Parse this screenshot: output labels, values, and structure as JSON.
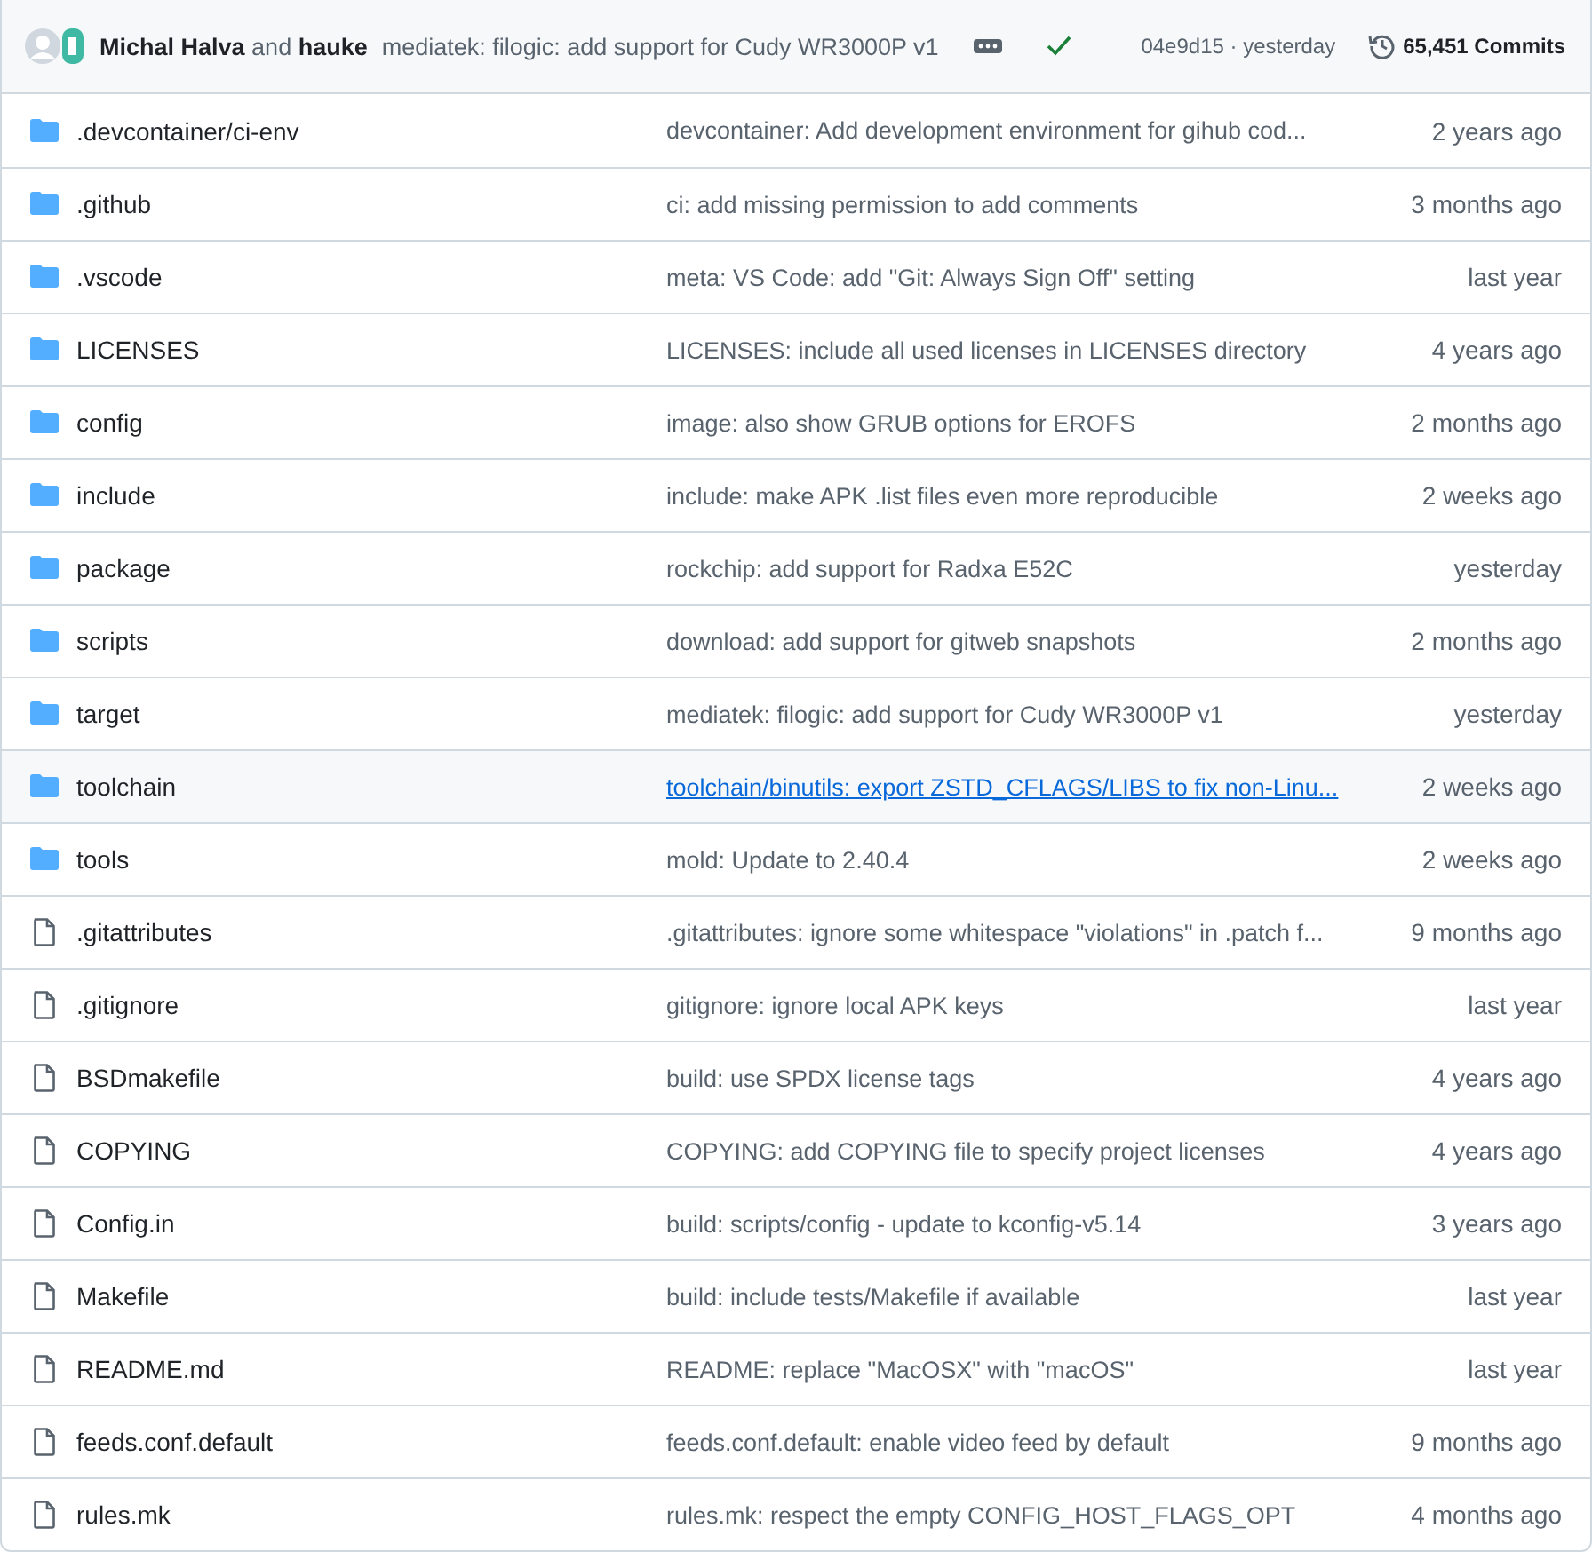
{
  "commit_header": {
    "author": "Michal Halva",
    "joiner": "and",
    "coauthor": "hauke",
    "message": "mediatek: filogic: add support for Cudy WR3000P v1",
    "checks_passed": true,
    "hash": "04e9d15",
    "separator": "·",
    "time": "yesterday",
    "commits": "65,451 Commits"
  },
  "files": [
    {
      "kind": "folder",
      "name": ".devcontainer/ci-env",
      "message": "devcontainer: Add development environment for gihub cod...",
      "time": "2 years ago",
      "hovered": false
    },
    {
      "kind": "folder",
      "name": ".github",
      "message": "ci: add missing permission to add comments",
      "time": "3 months ago",
      "hovered": false
    },
    {
      "kind": "folder",
      "name": ".vscode",
      "message": "meta: VS Code: add \"Git: Always Sign Off\" setting",
      "time": "last year",
      "hovered": false
    },
    {
      "kind": "folder",
      "name": "LICENSES",
      "message": "LICENSES: include all used licenses in LICENSES directory",
      "time": "4 years ago",
      "hovered": false
    },
    {
      "kind": "folder",
      "name": "config",
      "message": "image: also show GRUB options for EROFS",
      "time": "2 months ago",
      "hovered": false
    },
    {
      "kind": "folder",
      "name": "include",
      "message": "include: make APK .list files even more reproducible",
      "time": "2 weeks ago",
      "hovered": false
    },
    {
      "kind": "folder",
      "name": "package",
      "message": "rockchip: add support for Radxa E52C",
      "time": "yesterday",
      "hovered": false
    },
    {
      "kind": "folder",
      "name": "scripts",
      "message": "download: add support for gitweb snapshots",
      "time": "2 months ago",
      "hovered": false
    },
    {
      "kind": "folder",
      "name": "target",
      "message": "mediatek: filogic: add support for Cudy WR3000P v1",
      "time": "yesterday",
      "hovered": false
    },
    {
      "kind": "folder",
      "name": "toolchain",
      "message": "toolchain/binutils: export ZSTD_CFLAGS/LIBS to fix non-Linu...",
      "time": "2 weeks ago",
      "hovered": true
    },
    {
      "kind": "folder",
      "name": "tools",
      "message": "mold: Update to 2.40.4",
      "time": "2 weeks ago",
      "hovered": false
    },
    {
      "kind": "file",
      "name": ".gitattributes",
      "message": ".gitattributes: ignore some whitespace \"violations\" in .patch f...",
      "time": "9 months ago",
      "hovered": false
    },
    {
      "kind": "file",
      "name": ".gitignore",
      "message": "gitignore: ignore local APK keys",
      "time": "last year",
      "hovered": false
    },
    {
      "kind": "file",
      "name": "BSDmakefile",
      "message": "build: use SPDX license tags",
      "time": "4 years ago",
      "hovered": false
    },
    {
      "kind": "file",
      "name": "COPYING",
      "message": "COPYING: add COPYING file to specify project licenses",
      "time": "4 years ago",
      "hovered": false
    },
    {
      "kind": "file",
      "name": "Config.in",
      "message": "build: scripts/config - update to kconfig-v5.14",
      "time": "3 years ago",
      "hovered": false
    },
    {
      "kind": "file",
      "name": "Makefile",
      "message": "build: include tests/Makefile if available",
      "time": "last year",
      "hovered": false
    },
    {
      "kind": "file",
      "name": "README.md",
      "message": "README: replace \"MacOSX\" with \"macOS\"",
      "time": "last year",
      "hovered": false
    },
    {
      "kind": "file",
      "name": "feeds.conf.default",
      "message": "feeds.conf.default: enable video feed by default",
      "time": "9 months ago",
      "hovered": false
    },
    {
      "kind": "file",
      "name": "rules.mk",
      "message": "rules.mk: respect the empty CONFIG_HOST_FLAGS_OPT",
      "time": "4 months ago",
      "hovered": false
    }
  ]
}
